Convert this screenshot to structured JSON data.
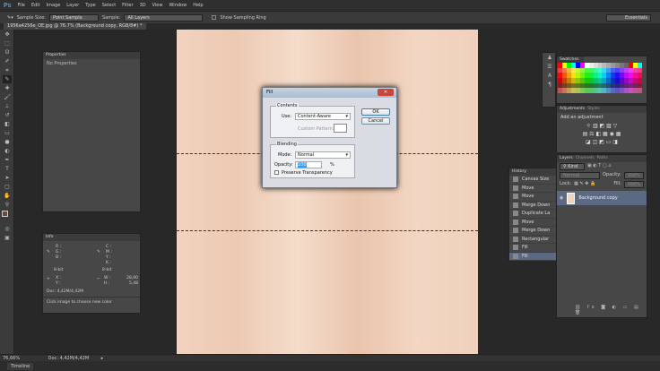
{
  "app": {
    "logo": "Ps",
    "menu": [
      "File",
      "Edit",
      "Image",
      "Layer",
      "Type",
      "Select",
      "Filter",
      "3D",
      "View",
      "Window",
      "Help"
    ],
    "workspace": "Essentials"
  },
  "options": {
    "sample_size_label": "Sample Size:",
    "sample_size": "Point Sample",
    "sample_label": "Sample:",
    "sample": "All Layers",
    "show_ring": "Show Sampling Ring"
  },
  "document": {
    "tab": "1956a4256e_OE.jpg @ 76.7% (Background copy, RGB/8#) *"
  },
  "properties": {
    "title": "Properties",
    "empty": "No Properties"
  },
  "info": {
    "title": "Info",
    "rgb": [
      "R :",
      "G :",
      "B :"
    ],
    "cmyk": [
      "C :",
      "M :",
      "Y :",
      "K :"
    ],
    "bit1": "8-bit",
    "bit2": "8-bit",
    "xy": [
      "X :",
      "Y :"
    ],
    "w_label": "W :",
    "w": "28,00",
    "h_label": "H :",
    "h": "5,48",
    "doc": "Doc: 4,42M/4,42M",
    "hint": "Click image to choose new color"
  },
  "dialog": {
    "title": "Fill",
    "contents": "Contents",
    "use_label": "Use:",
    "use": "Content-Aware",
    "custom_pattern": "Custom Pattern:",
    "ok": "OK",
    "cancel": "Cancel",
    "blending": "Blending",
    "mode_label": "Mode:",
    "mode": "Normal",
    "opacity_label": "Opacity:",
    "opacity": "100",
    "pct": "%",
    "preserve": "Preserve Transparency"
  },
  "swatches": {
    "title": "Swatches"
  },
  "adjustments": {
    "tabs": [
      "Adjustments",
      "Styles"
    ],
    "add": "Add an adjustment"
  },
  "layers": {
    "tabs": [
      "Layers",
      "Channels",
      "Paths"
    ],
    "kind": "Kind",
    "blend": "Normal",
    "opacity_label": "Opacity:",
    "opacity": "100%",
    "lock_label": "Lock:",
    "fill_label": "Fill:",
    "fill": "100%",
    "layer": "Background copy"
  },
  "history": {
    "title": "History",
    "items": [
      "Canvas Size",
      "Move",
      "Move",
      "Merge Down",
      "Duplicate La",
      "Move",
      "Merge Down",
      "Rectangular",
      "Fill",
      "Fill"
    ]
  },
  "status": {
    "zoom": "76,66%",
    "doc": "Doc: 4,42M/4,42M"
  },
  "timeline": {
    "label": "Timeline"
  }
}
